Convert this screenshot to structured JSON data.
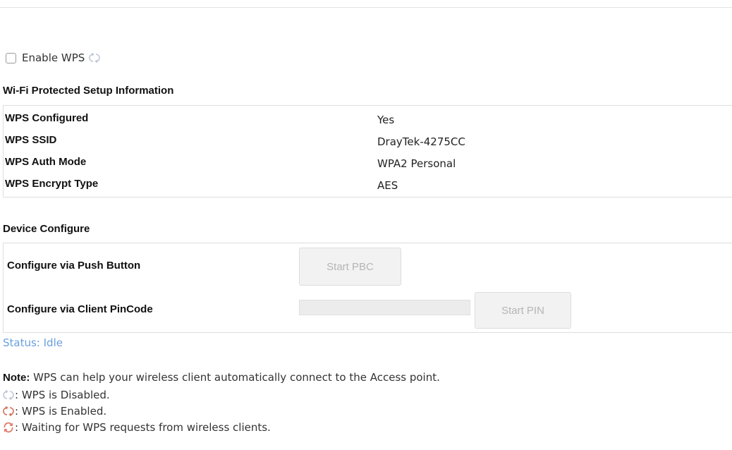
{
  "enable_wps": {
    "label": "Enable WPS",
    "checked": false,
    "icon": "wps-disabled-icon"
  },
  "wps_info": {
    "title": "Wi-Fi Protected Setup Information",
    "rows": [
      {
        "label": "WPS Configured",
        "value": "Yes"
      },
      {
        "label": "WPS SSID",
        "value": "DrayTek-4275CC"
      },
      {
        "label": "WPS Auth Mode",
        "value": "WPA2 Personal"
      },
      {
        "label": "WPS Encrypt Type",
        "value": "AES"
      }
    ]
  },
  "device_configure": {
    "title": "Device Configure",
    "push_button": {
      "label": "Configure via Push Button",
      "button": "Start PBC"
    },
    "pin_code": {
      "label": "Configure via Client PinCode",
      "value": "",
      "button": "Start PIN"
    }
  },
  "status": "Status: Idle",
  "note": {
    "prefix": "Note:",
    "text": " WPS can help your wireless client automatically connect to the Access point.",
    "legend": [
      {
        "icon": "wps-disabled-icon",
        "text": ": WPS is Disabled."
      },
      {
        "icon": "wps-enabled-icon",
        "text": ": WPS is Enabled."
      },
      {
        "icon": "wps-waiting-icon",
        "text": ": Waiting for WPS requests from wireless clients."
      }
    ]
  },
  "colors": {
    "status": "#6aa0dc",
    "disabled_icon": "#c0c8d8",
    "enabled_icon": "#d2735a",
    "waiting_icon": "#e07a6a"
  }
}
